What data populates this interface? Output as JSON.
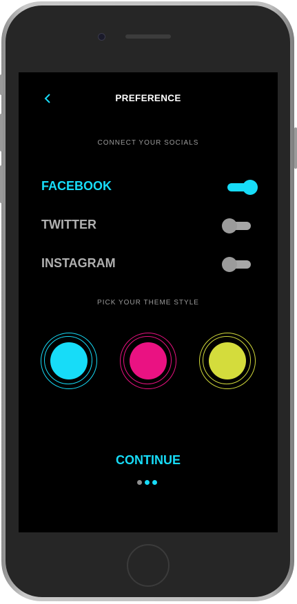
{
  "header": {
    "title": "PREFERENCE",
    "back_icon": "chevron-left-icon"
  },
  "socials": {
    "label": "CONNECT YOUR SOCIALS",
    "items": [
      {
        "name": "FACEBOOK",
        "enabled": true
      },
      {
        "name": "TWITTER",
        "enabled": false
      },
      {
        "name": "INSTAGRAM",
        "enabled": false
      }
    ]
  },
  "theme": {
    "label": "PICK YOUR THEME STYLE",
    "colors": [
      "#17dcf8",
      "#ea1282",
      "#d4dc3c"
    ]
  },
  "footer": {
    "continue_label": "CONTINUE",
    "pagination": {
      "total": 3,
      "active": 2
    }
  },
  "accent_color": "#17dcf8"
}
